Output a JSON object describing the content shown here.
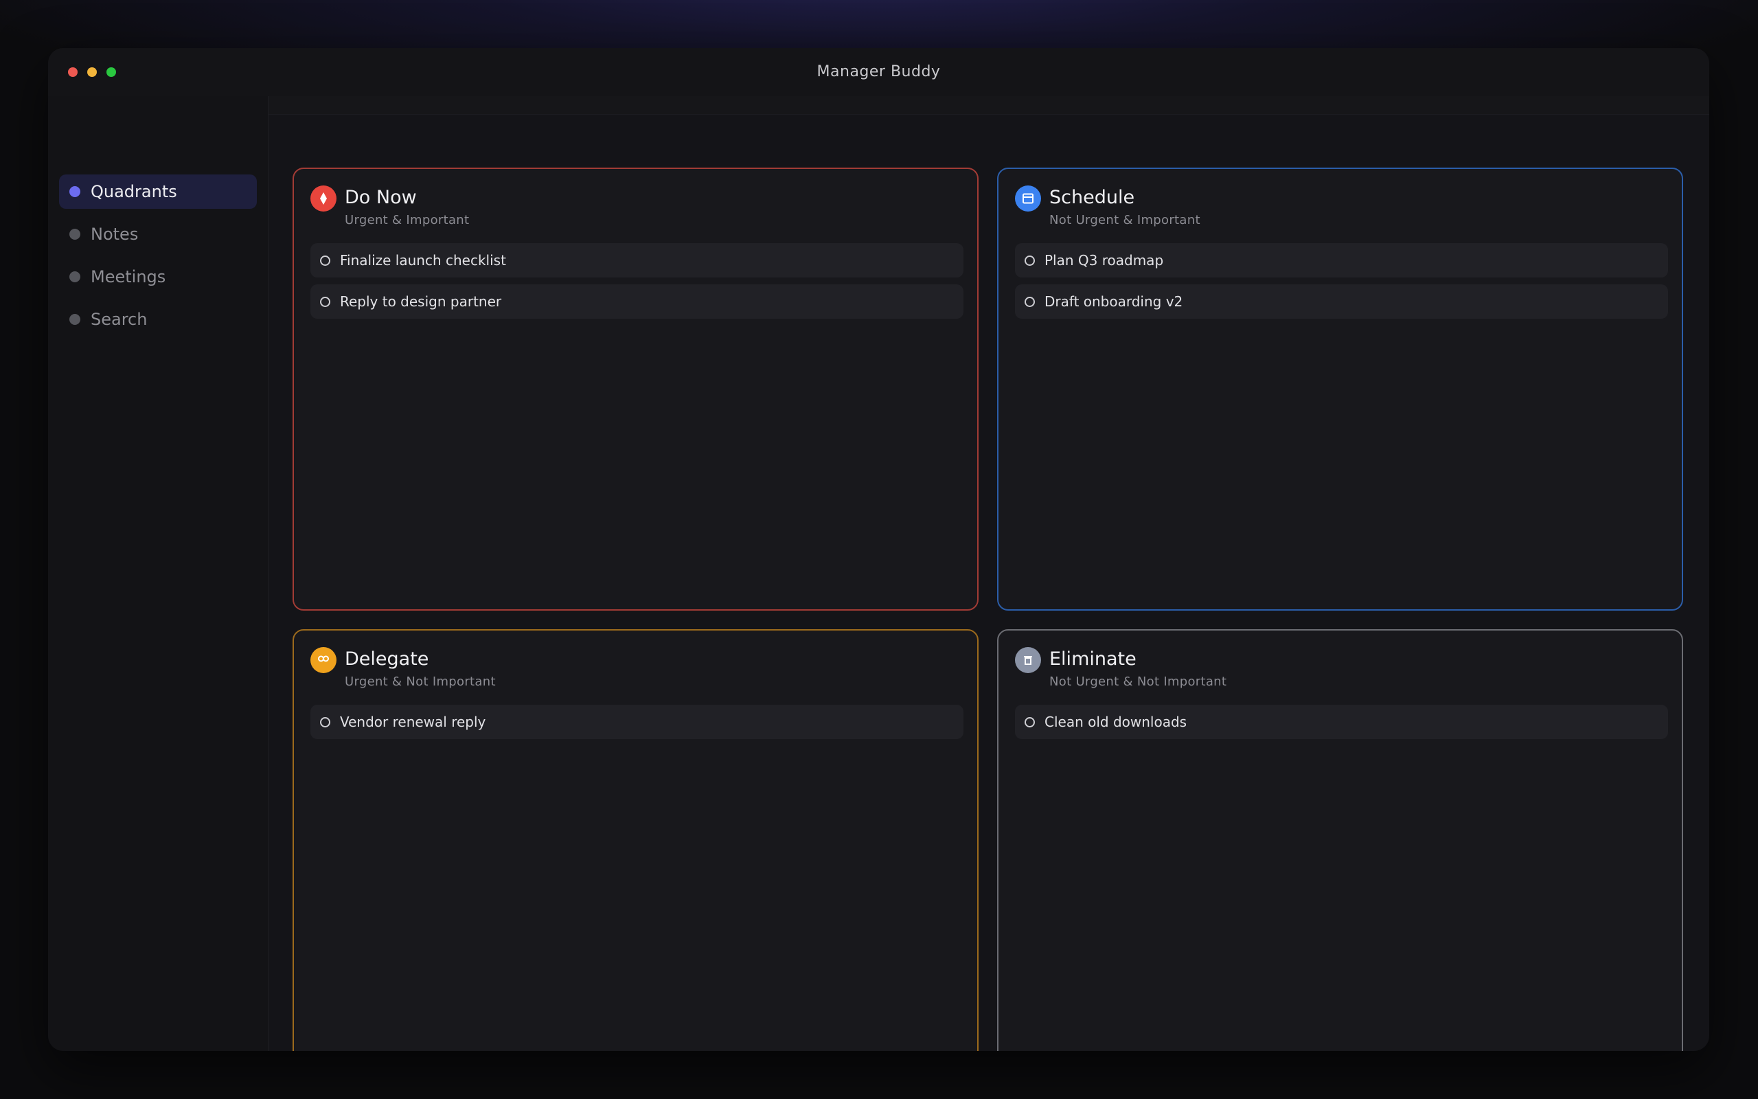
{
  "window": {
    "title": "Manager Buddy"
  },
  "sidebar": {
    "items": [
      {
        "label": "Quadrants",
        "active": true
      },
      {
        "label": "Notes",
        "active": false
      },
      {
        "label": "Meetings",
        "active": false
      },
      {
        "label": "Search",
        "active": false
      }
    ]
  },
  "quadrants": {
    "do_now": {
      "title": "Do Now",
      "subtitle": "Urgent & Important",
      "icon": "flame-icon",
      "color": "#e8453c",
      "tasks": [
        {
          "label": "Finalize launch checklist"
        },
        {
          "label": "Reply to design partner"
        }
      ]
    },
    "schedule": {
      "title": "Schedule",
      "subtitle": "Not Urgent & Important",
      "icon": "calendar-icon",
      "color": "#3b82f0",
      "tasks": [
        {
          "label": "Plan Q3 roadmap"
        },
        {
          "label": "Draft onboarding v2"
        }
      ]
    },
    "delegate": {
      "title": "Delegate",
      "subtitle": "Urgent & Not Important",
      "icon": "people-icon",
      "color": "#f0a21d",
      "tasks": [
        {
          "label": "Vendor renewal reply"
        }
      ]
    },
    "eliminate": {
      "title": "Eliminate",
      "subtitle": "Not Urgent & Not Important",
      "icon": "trash-icon",
      "color": "#8a93a6",
      "tasks": [
        {
          "label": "Clean old downloads"
        }
      ]
    }
  }
}
